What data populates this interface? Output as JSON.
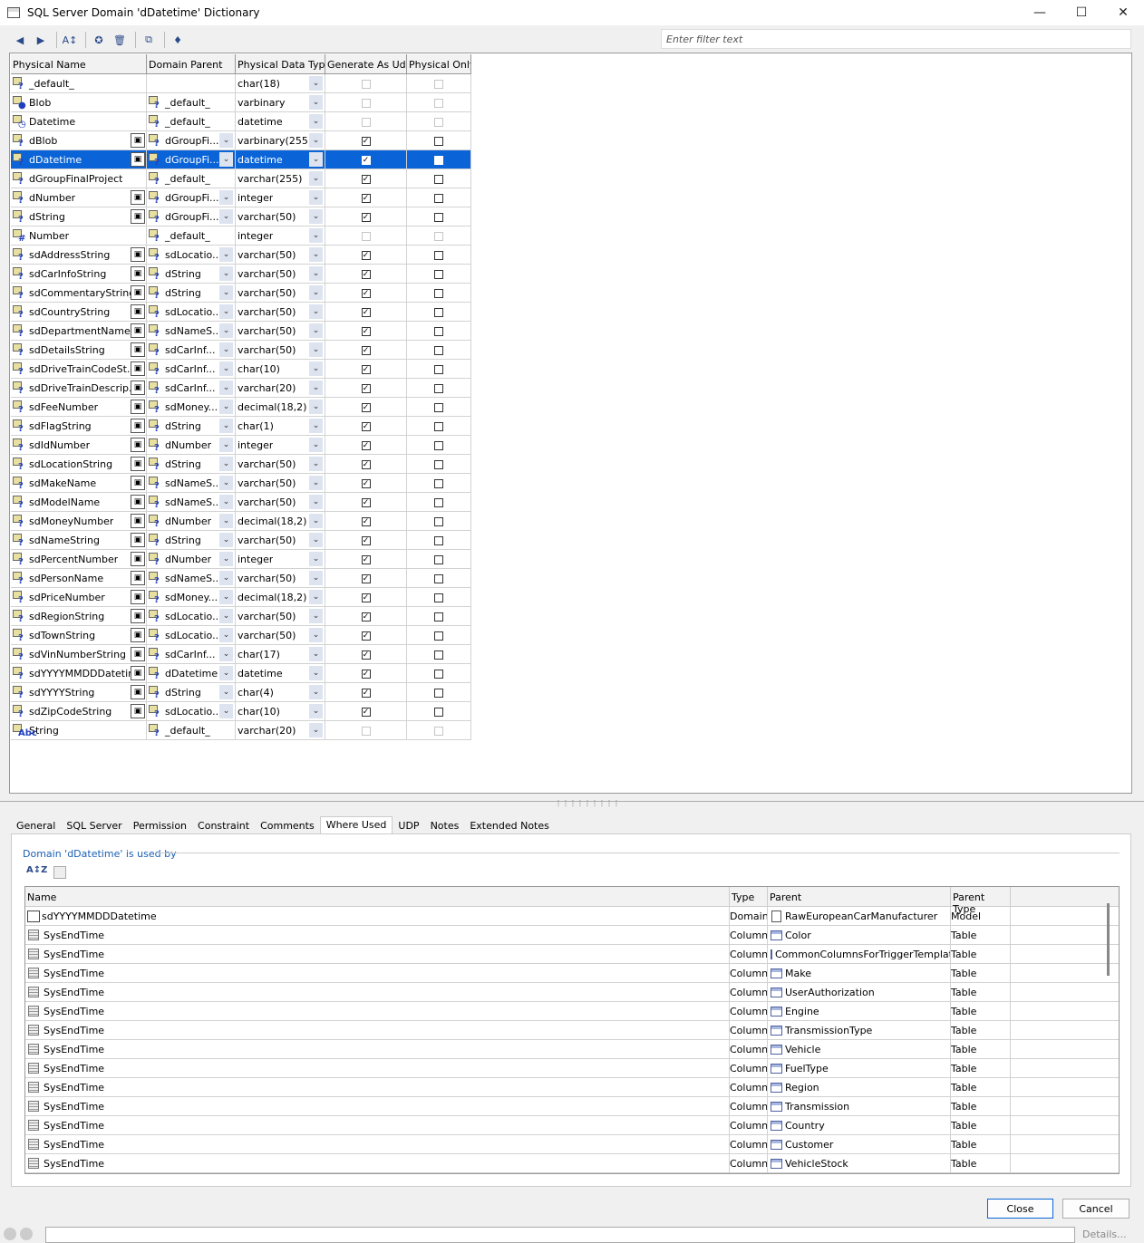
{
  "window": {
    "title": "SQL Server Domain 'dDatetime' Dictionary"
  },
  "filter": {
    "placeholder": "Enter filter text"
  },
  "grid": {
    "headers": [
      "Physical Name",
      "Domain Parent",
      "Physical Data Type",
      "Generate As Udd",
      "Physical Only"
    ],
    "rows": [
      {
        "name": "_default_",
        "parent": "",
        "type": "char(18)",
        "gen": false,
        "gen_enabled": false,
        "phys": false,
        "phys_enabled": false,
        "editable": false,
        "icon": "?"
      },
      {
        "name": "Blob",
        "parent": "_default_",
        "type": "varbinary",
        "gen": false,
        "gen_enabled": false,
        "phys": false,
        "phys_enabled": false,
        "editable": false,
        "icon": "●"
      },
      {
        "name": "Datetime",
        "parent": "_default_",
        "type": "datetime",
        "gen": false,
        "gen_enabled": false,
        "phys": false,
        "phys_enabled": false,
        "editable": false,
        "icon": "◷"
      },
      {
        "name": "dBlob",
        "parent": "dGroupFi...",
        "type": "varbinary(255)",
        "gen": true,
        "gen_enabled": true,
        "phys": false,
        "phys_enabled": true,
        "editable": true,
        "icon": "?"
      },
      {
        "name": "dDatetime",
        "parent": "dGroupFi...",
        "type": "datetime",
        "gen": true,
        "gen_enabled": true,
        "phys": false,
        "phys_enabled": true,
        "editable": true,
        "icon": "?",
        "selected": true
      },
      {
        "name": "dGroupFinalProject",
        "parent": "_default_",
        "type": "varchar(255)",
        "gen": true,
        "gen_enabled": true,
        "phys": false,
        "phys_enabled": true,
        "editable": false,
        "icon": "?"
      },
      {
        "name": "dNumber",
        "parent": "dGroupFi...",
        "type": "integer",
        "gen": true,
        "gen_enabled": true,
        "phys": false,
        "phys_enabled": true,
        "editable": true,
        "icon": "?"
      },
      {
        "name": "dString",
        "parent": "dGroupFi...",
        "type": "varchar(50)",
        "gen": true,
        "gen_enabled": true,
        "phys": false,
        "phys_enabled": true,
        "editable": true,
        "icon": "?"
      },
      {
        "name": "Number",
        "parent": "_default_",
        "type": "integer",
        "gen": false,
        "gen_enabled": false,
        "phys": false,
        "phys_enabled": false,
        "editable": false,
        "icon": "#"
      },
      {
        "name": "sdAddressString",
        "parent": "sdLocatio...",
        "type": "varchar(50)",
        "gen": true,
        "gen_enabled": true,
        "phys": false,
        "phys_enabled": true,
        "editable": true,
        "icon": "?"
      },
      {
        "name": "sdCarInfoString",
        "parent": "dString",
        "type": "varchar(50)",
        "gen": true,
        "gen_enabled": true,
        "phys": false,
        "phys_enabled": true,
        "editable": true,
        "icon": "?"
      },
      {
        "name": "sdCommentaryString",
        "parent": "dString",
        "type": "varchar(50)",
        "gen": true,
        "gen_enabled": true,
        "phys": false,
        "phys_enabled": true,
        "editable": true,
        "icon": "?"
      },
      {
        "name": "sdCountryString",
        "parent": "sdLocatio...",
        "type": "varchar(50)",
        "gen": true,
        "gen_enabled": true,
        "phys": false,
        "phys_enabled": true,
        "editable": true,
        "icon": "?"
      },
      {
        "name": "sdDepartmentName",
        "parent": "sdNameS...",
        "type": "varchar(50)",
        "gen": true,
        "gen_enabled": true,
        "phys": false,
        "phys_enabled": true,
        "editable": true,
        "icon": "?"
      },
      {
        "name": "sdDetailsString",
        "parent": "sdCarInf...",
        "type": "varchar(50)",
        "gen": true,
        "gen_enabled": true,
        "phys": false,
        "phys_enabled": true,
        "editable": true,
        "icon": "?"
      },
      {
        "name": "sdDriveTrainCodeSt...",
        "parent": "sdCarInf...",
        "type": "char(10)",
        "gen": true,
        "gen_enabled": true,
        "phys": false,
        "phys_enabled": true,
        "editable": true,
        "icon": "?"
      },
      {
        "name": "sdDriveTrainDescrip...",
        "parent": "sdCarInf...",
        "type": "varchar(20)",
        "gen": true,
        "gen_enabled": true,
        "phys": false,
        "phys_enabled": true,
        "editable": true,
        "icon": "?"
      },
      {
        "name": "sdFeeNumber",
        "parent": "sdMoney...",
        "type": "decimal(18,2)",
        "gen": true,
        "gen_enabled": true,
        "phys": false,
        "phys_enabled": true,
        "editable": true,
        "icon": "?"
      },
      {
        "name": "sdFlagString",
        "parent": "dString",
        "type": "char(1)",
        "gen": true,
        "gen_enabled": true,
        "phys": false,
        "phys_enabled": true,
        "editable": true,
        "icon": "?"
      },
      {
        "name": "sdIdNumber",
        "parent": "dNumber",
        "type": "integer",
        "gen": true,
        "gen_enabled": true,
        "phys": false,
        "phys_enabled": true,
        "editable": true,
        "icon": "?"
      },
      {
        "name": "sdLocationString",
        "parent": "dString",
        "type": "varchar(50)",
        "gen": true,
        "gen_enabled": true,
        "phys": false,
        "phys_enabled": true,
        "editable": true,
        "icon": "?"
      },
      {
        "name": "sdMakeName",
        "parent": "sdNameS...",
        "type": "varchar(50)",
        "gen": true,
        "gen_enabled": true,
        "phys": false,
        "phys_enabled": true,
        "editable": true,
        "icon": "?"
      },
      {
        "name": "sdModelName",
        "parent": "sdNameS...",
        "type": "varchar(50)",
        "gen": true,
        "gen_enabled": true,
        "phys": false,
        "phys_enabled": true,
        "editable": true,
        "icon": "?"
      },
      {
        "name": "sdMoneyNumber",
        "parent": "dNumber",
        "type": "decimal(18,2)",
        "gen": true,
        "gen_enabled": true,
        "phys": false,
        "phys_enabled": true,
        "editable": true,
        "icon": "?"
      },
      {
        "name": "sdNameString",
        "parent": "dString",
        "type": "varchar(50)",
        "gen": true,
        "gen_enabled": true,
        "phys": false,
        "phys_enabled": true,
        "editable": true,
        "icon": "?"
      },
      {
        "name": "sdPercentNumber",
        "parent": "dNumber",
        "type": "integer",
        "gen": true,
        "gen_enabled": true,
        "phys": false,
        "phys_enabled": true,
        "editable": true,
        "icon": "?"
      },
      {
        "name": "sdPersonName",
        "parent": "sdNameS...",
        "type": "varchar(50)",
        "gen": true,
        "gen_enabled": true,
        "phys": false,
        "phys_enabled": true,
        "editable": true,
        "icon": "?"
      },
      {
        "name": "sdPriceNumber",
        "parent": "sdMoney...",
        "type": "decimal(18,2)",
        "gen": true,
        "gen_enabled": true,
        "phys": false,
        "phys_enabled": true,
        "editable": true,
        "icon": "?"
      },
      {
        "name": "sdRegionString",
        "parent": "sdLocatio...",
        "type": "varchar(50)",
        "gen": true,
        "gen_enabled": true,
        "phys": false,
        "phys_enabled": true,
        "editable": true,
        "icon": "?"
      },
      {
        "name": "sdTownString",
        "parent": "sdLocatio...",
        "type": "varchar(50)",
        "gen": true,
        "gen_enabled": true,
        "phys": false,
        "phys_enabled": true,
        "editable": true,
        "icon": "?"
      },
      {
        "name": "sdVinNumberString",
        "parent": "sdCarInf...",
        "type": "char(17)",
        "gen": true,
        "gen_enabled": true,
        "phys": false,
        "phys_enabled": true,
        "editable": true,
        "icon": "?"
      },
      {
        "name": "sdYYYYMMDDDatetime",
        "parent": "dDatetime",
        "type": "datetime",
        "gen": true,
        "gen_enabled": true,
        "phys": false,
        "phys_enabled": true,
        "editable": true,
        "icon": "?"
      },
      {
        "name": "sdYYYYString",
        "parent": "dString",
        "type": "char(4)",
        "gen": true,
        "gen_enabled": true,
        "phys": false,
        "phys_enabled": true,
        "editable": true,
        "icon": "?"
      },
      {
        "name": "sdZipCodeString",
        "parent": "sdLocatio...",
        "type": "char(10)",
        "gen": true,
        "gen_enabled": true,
        "phys": false,
        "phys_enabled": true,
        "editable": true,
        "icon": "?"
      },
      {
        "name": "String",
        "parent": "_default_",
        "type": "varchar(20)",
        "gen": false,
        "gen_enabled": false,
        "phys": false,
        "phys_enabled": false,
        "editable": false,
        "icon": "Abc"
      }
    ]
  },
  "tabs": [
    "General",
    "SQL Server",
    "Permission",
    "Constraint",
    "Comments",
    "Where Used",
    "UDP",
    "Notes",
    "Extended Notes"
  ],
  "active_tab": "Where Used",
  "where_used": {
    "label": "Domain 'dDatetime' is used by",
    "headers": [
      "Name",
      "Type",
      "Parent",
      "Parent Type"
    ],
    "rows": [
      {
        "name": "sdYYYYMMDDDatetime",
        "type": "Domain",
        "parent": "RawEuropeanCarManufacturer",
        "parent_type": "Model",
        "kind": "domain"
      },
      {
        "name": "SysEndTime",
        "type": "Column",
        "parent": "Color",
        "parent_type": "Table",
        "kind": "column"
      },
      {
        "name": "SysEndTime",
        "type": "Column",
        "parent": "CommonColumnsForTriggerTemplate",
        "parent_type": "Table",
        "kind": "column"
      },
      {
        "name": "SysEndTime",
        "type": "Column",
        "parent": "Make",
        "parent_type": "Table",
        "kind": "column"
      },
      {
        "name": "SysEndTime",
        "type": "Column",
        "parent": "UserAuthorization",
        "parent_type": "Table",
        "kind": "column"
      },
      {
        "name": "SysEndTime",
        "type": "Column",
        "parent": "Engine",
        "parent_type": "Table",
        "kind": "column"
      },
      {
        "name": "SysEndTime",
        "type": "Column",
        "parent": "TransmissionType",
        "parent_type": "Table",
        "kind": "column"
      },
      {
        "name": "SysEndTime",
        "type": "Column",
        "parent": "Vehicle",
        "parent_type": "Table",
        "kind": "column"
      },
      {
        "name": "SysEndTime",
        "type": "Column",
        "parent": "FuelType",
        "parent_type": "Table",
        "kind": "column"
      },
      {
        "name": "SysEndTime",
        "type": "Column",
        "parent": "Region",
        "parent_type": "Table",
        "kind": "column"
      },
      {
        "name": "SysEndTime",
        "type": "Column",
        "parent": "Transmission",
        "parent_type": "Table",
        "kind": "column"
      },
      {
        "name": "SysEndTime",
        "type": "Column",
        "parent": "Country",
        "parent_type": "Table",
        "kind": "column"
      },
      {
        "name": "SysEndTime",
        "type": "Column",
        "parent": "Customer",
        "parent_type": "Table",
        "kind": "column"
      },
      {
        "name": "SysEndTime",
        "type": "Column",
        "parent": "VehicleStock",
        "parent_type": "Table",
        "kind": "column"
      }
    ]
  },
  "buttons": {
    "close": "Close",
    "cancel": "Cancel",
    "details": "Details..."
  },
  "colors": {
    "selection": "#0a64d7",
    "link_blue": "#1a5fb4"
  }
}
